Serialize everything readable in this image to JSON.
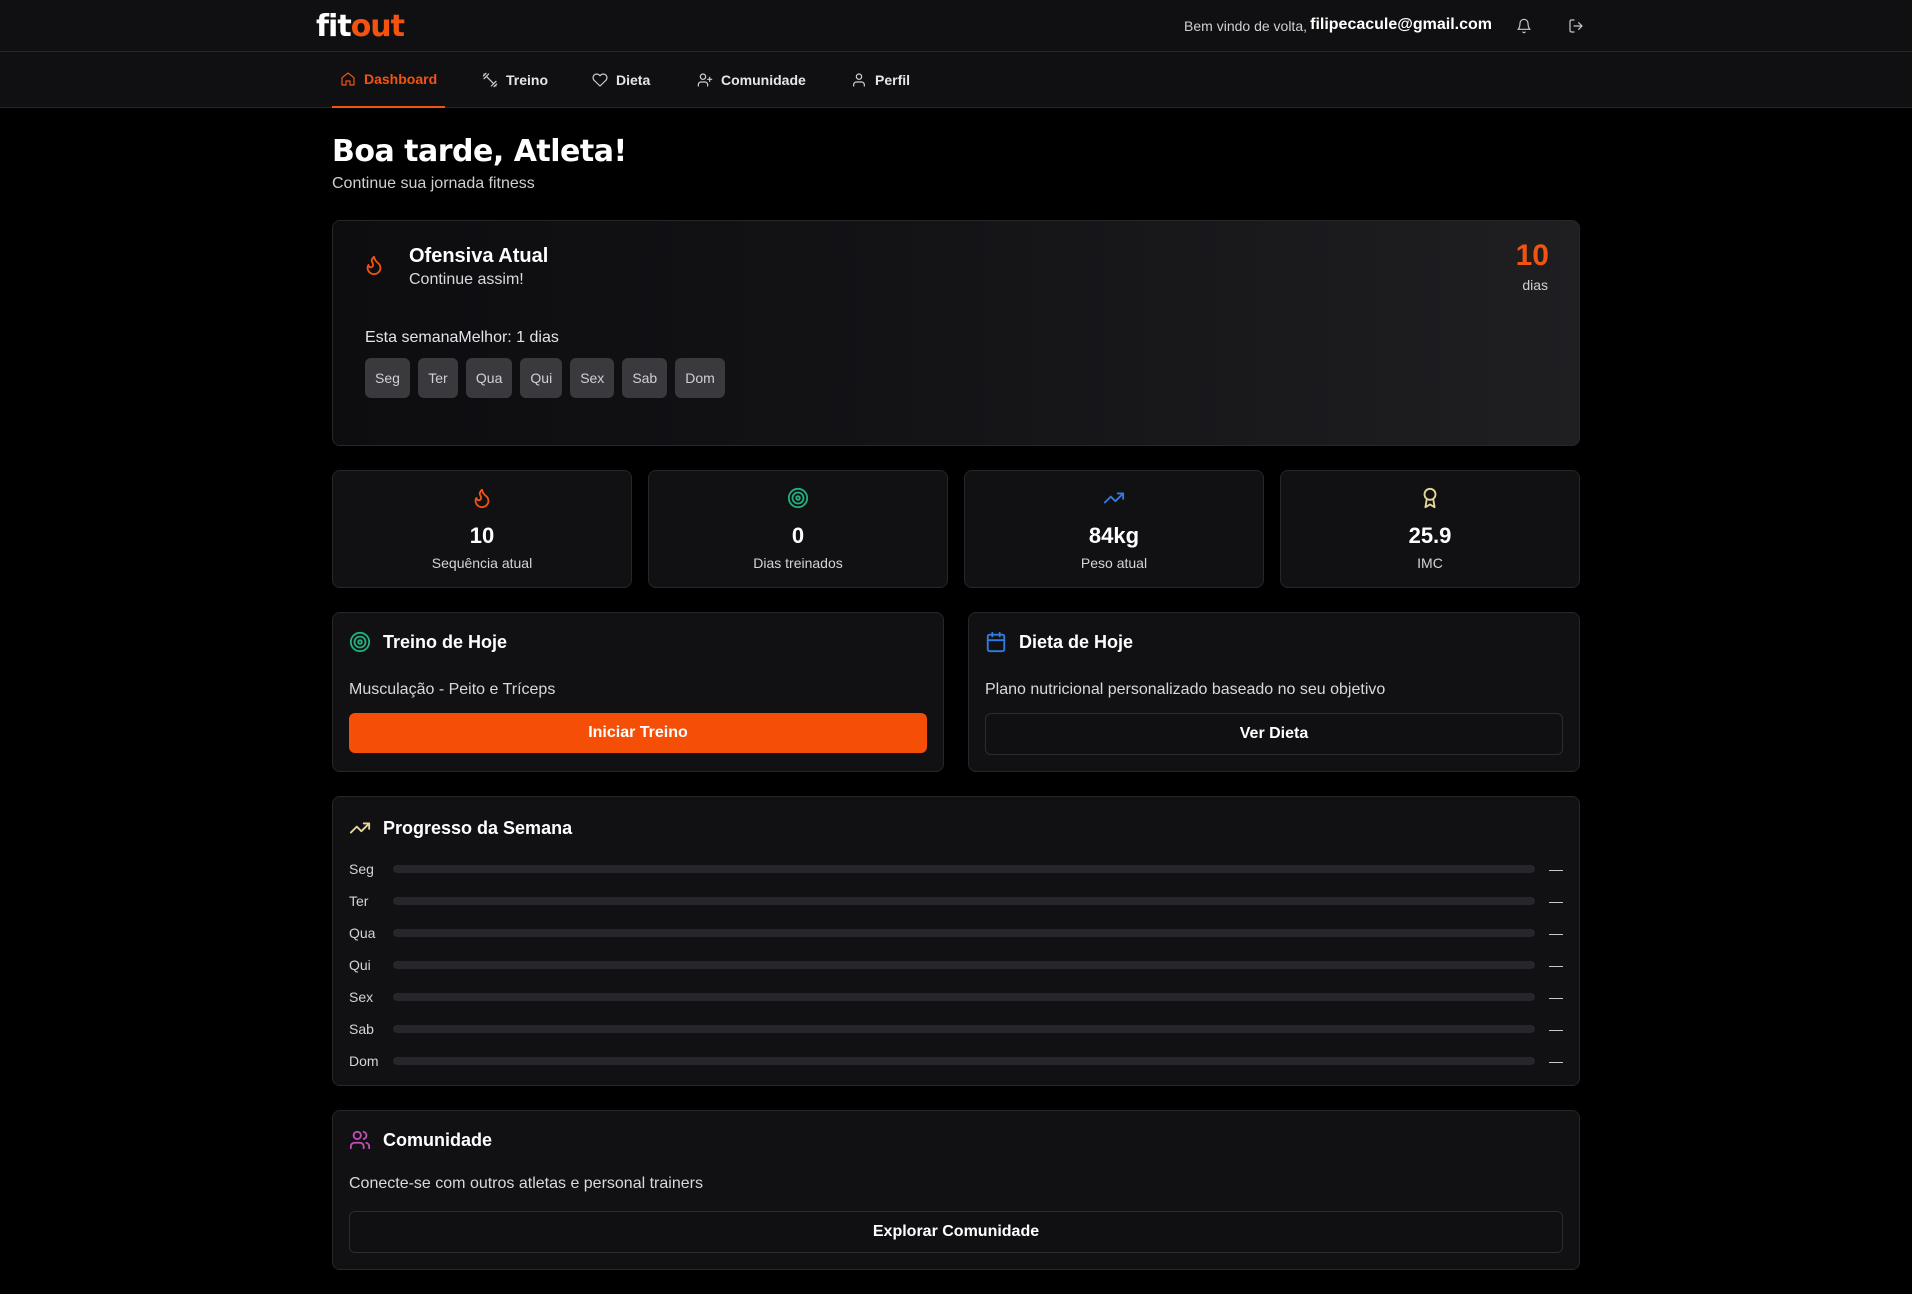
{
  "brand": {
    "part1": "fit",
    "part2": "out"
  },
  "header": {
    "welcome": "Bem vindo de volta,",
    "email": "filipecacule@gmail.com",
    "bell_icon": "bell-icon",
    "logout_icon": "logout-icon"
  },
  "nav": {
    "tabs": [
      {
        "label": "Dashboard",
        "icon": "home-icon",
        "active": true
      },
      {
        "label": "Treino",
        "icon": "dumbbell-icon",
        "active": false
      },
      {
        "label": "Dieta",
        "icon": "heart-icon",
        "active": false
      },
      {
        "label": "Comunidade",
        "icon": "user-plus-icon",
        "active": false
      },
      {
        "label": "Perfil",
        "icon": "user-icon",
        "active": false
      }
    ]
  },
  "greeting": {
    "title": "Boa tarde, Atleta!",
    "subtitle": "Continue sua jornada fitness"
  },
  "streak": {
    "title": "Ofensiva Atual",
    "subtitle": "Continue assim!",
    "count": "10",
    "unit": "dias",
    "week_label": "Esta semanaMelhor: 1 dias",
    "days": [
      "Seg",
      "Ter",
      "Qua",
      "Qui",
      "Sex",
      "Sab",
      "Dom"
    ]
  },
  "stats": [
    {
      "value": "10",
      "label": "Sequência atual",
      "icon": "flame-icon",
      "color": "#f25410"
    },
    {
      "value": "0",
      "label": "Dias treinados",
      "icon": "target-icon",
      "color": "#22b07d"
    },
    {
      "value": "84kg",
      "label": "Peso atual",
      "icon": "trending-up-icon",
      "color": "#2f7de1"
    },
    {
      "value": "25.9",
      "label": "IMC",
      "icon": "award-icon",
      "color": "#e8d79a"
    }
  ],
  "workout": {
    "title": "Treino de Hoje",
    "text": "Musculação - Peito e Tríceps",
    "button": "Iniciar Treino"
  },
  "diet": {
    "title": "Dieta de Hoje",
    "text": "Plano nutricional personalizado baseado no seu objetivo",
    "button": "Ver Dieta"
  },
  "progress": {
    "title": "Progresso da Semana",
    "rows": [
      {
        "day": "Seg",
        "value": "—",
        "fraction": 0
      },
      {
        "day": "Ter",
        "value": "—",
        "fraction": 0
      },
      {
        "day": "Qua",
        "value": "—",
        "fraction": 0
      },
      {
        "day": "Qui",
        "value": "—",
        "fraction": 0
      },
      {
        "day": "Sex",
        "value": "—",
        "fraction": 0
      },
      {
        "day": "Sab",
        "value": "—",
        "fraction": 0
      },
      {
        "day": "Dom",
        "value": "—",
        "fraction": 0
      }
    ]
  },
  "community": {
    "title": "Comunidade",
    "text": "Conecte-se com outros atletas e personal trainers",
    "button": "Explorar Comunidade"
  },
  "colors": {
    "accent": "#f25410",
    "background": "#000000",
    "card": "#111114"
  }
}
